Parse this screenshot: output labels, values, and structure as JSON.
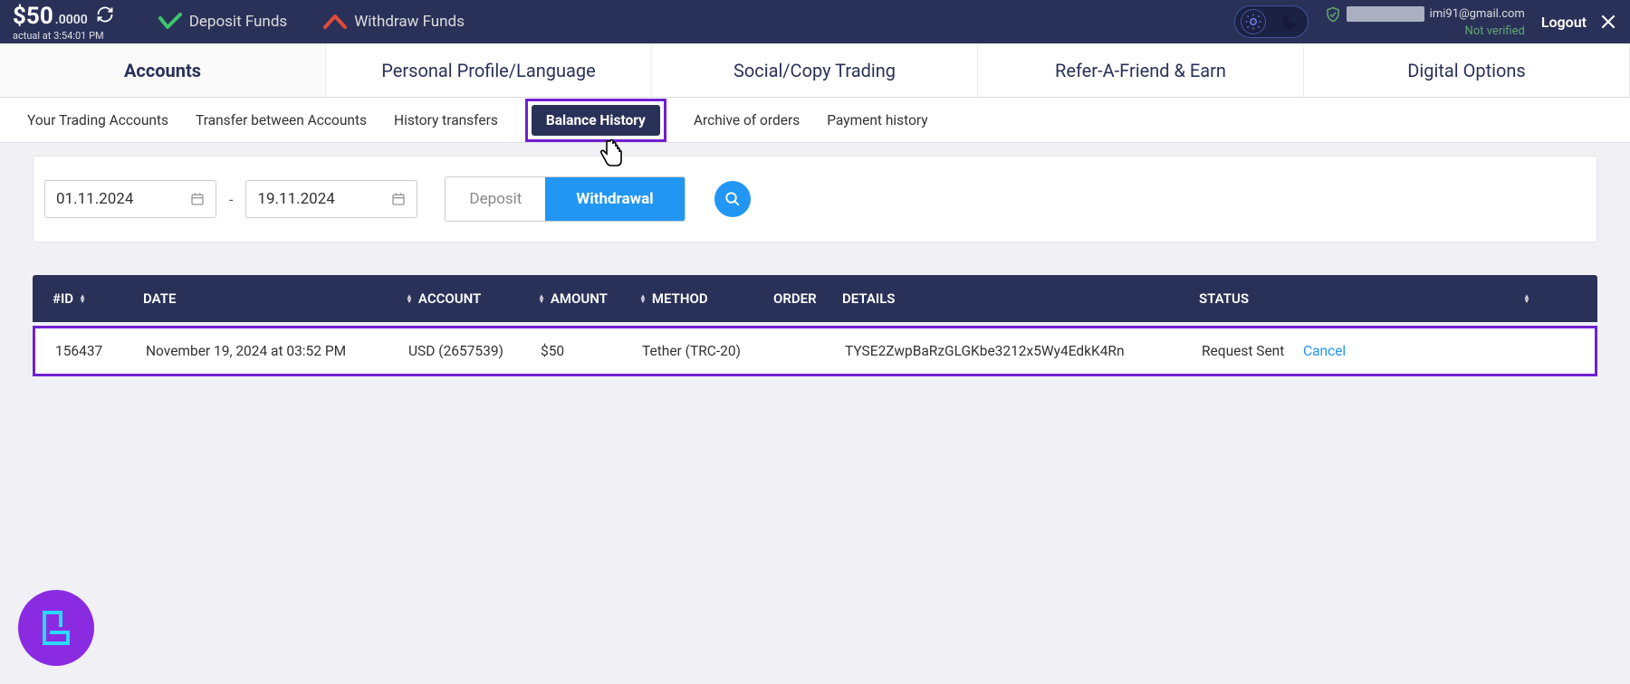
{
  "header": {
    "balance_currency": "$",
    "balance_int": "50",
    "balance_dec": ".0000",
    "balance_sub": "actual at 3:54:01 PM",
    "deposit_label": "Deposit Funds",
    "withdraw_label": "Withdraw Funds",
    "user_email_hidden": "imi91@gmail.com",
    "not_verified": "Not verified",
    "logout": "Logout"
  },
  "main_tabs": {
    "accounts": "Accounts",
    "profile": "Personal Profile/Language",
    "social": "Social/Copy Trading",
    "refer": "Refer-A-Friend & Earn",
    "digital": "Digital Options"
  },
  "sub_tabs": {
    "your_accounts": "Your Trading Accounts",
    "transfer": "Transfer between Accounts",
    "history_transfers": "History transfers",
    "balance_history": "Balance History",
    "archive": "Archive of orders",
    "payment": "Payment history"
  },
  "filters": {
    "date_from": "01.11.2024",
    "date_to": "19.11.2024",
    "deposit": "Deposit",
    "withdrawal": "Withdrawal"
  },
  "table": {
    "headers": {
      "id": "#ID",
      "date": "DATE",
      "account": "ACCOUNT",
      "amount": "AMOUNT",
      "method": "METHOD",
      "order": "ORDER",
      "details": "DETAILS",
      "status": "STATUS"
    },
    "rows": [
      {
        "id": "156437",
        "date": "November 19, 2024 at 03:52 PM",
        "account": "USD (2657539)",
        "amount": "$50",
        "method": "Tether (TRC-20)",
        "order": "",
        "details": "TYSE2ZwpBaRzGLGKbe3212x5Wy4EdkK4Rn",
        "status": "Request Sent",
        "action": "Cancel"
      }
    ]
  }
}
